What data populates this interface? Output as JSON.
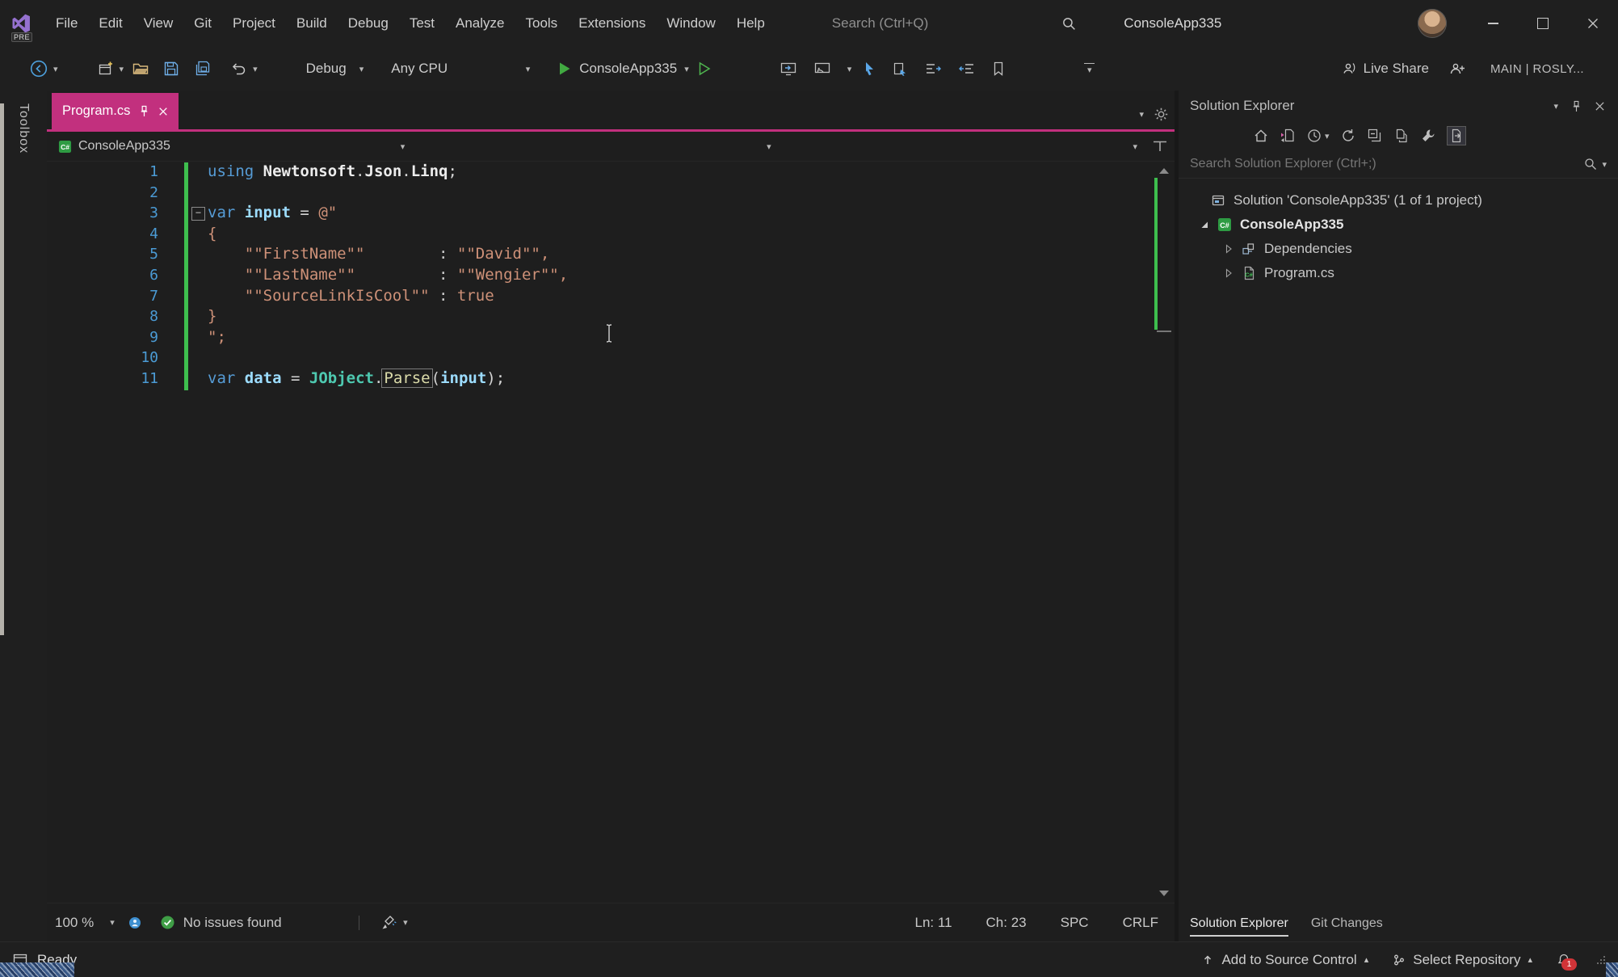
{
  "titlebar": {
    "logo_badge": "PRE",
    "menus": [
      "File",
      "Edit",
      "View",
      "Git",
      "Project",
      "Build",
      "Debug",
      "Test",
      "Analyze",
      "Tools",
      "Extensions",
      "Window",
      "Help"
    ],
    "search": "Search (Ctrl+Q)",
    "title": "ConsoleApp335"
  },
  "toolbar": {
    "config": "Debug",
    "platform": "Any CPU",
    "run_target": "ConsoleApp335",
    "live_share": "Live Share",
    "branch": "MAIN | ROSLY..."
  },
  "left_rail": {
    "toolbox": "Toolbox"
  },
  "editor": {
    "tab": {
      "title": "Program.cs"
    },
    "breadcrumb": {
      "project": "ConsoleApp335"
    },
    "fold_marker": "−",
    "code_lines": [
      {
        "n": "1",
        "tokens": [
          {
            "c": "k",
            "t": "using"
          },
          {
            "c": "p",
            "t": " "
          },
          {
            "c": "n",
            "t": "Newtonsoft"
          },
          {
            "c": "p",
            "t": "."
          },
          {
            "c": "n",
            "t": "Json"
          },
          {
            "c": "p",
            "t": "."
          },
          {
            "c": "n",
            "t": "Linq"
          },
          {
            "c": "p",
            "t": ";"
          }
        ]
      },
      {
        "n": "2",
        "tokens": []
      },
      {
        "n": "3",
        "tokens": [
          {
            "c": "k",
            "t": "var"
          },
          {
            "c": "p",
            "t": " "
          },
          {
            "c": "i",
            "t": "input"
          },
          {
            "c": "p",
            "t": " = "
          },
          {
            "c": "s",
            "t": "@\""
          }
        ]
      },
      {
        "n": "4",
        "tokens": [
          {
            "c": "s",
            "t": "{"
          }
        ]
      },
      {
        "n": "5",
        "tokens": [
          {
            "c": "s",
            "t": "    \"\"FirstName\"\"        "
          },
          {
            "c": "c",
            "t": ":"
          },
          {
            "c": "s",
            "t": " \"\"David\"\","
          }
        ]
      },
      {
        "n": "6",
        "tokens": [
          {
            "c": "s",
            "t": "    \"\"LastName\"\"         "
          },
          {
            "c": "c",
            "t": ":"
          },
          {
            "c": "s",
            "t": " \"\"Wengier\"\","
          }
        ]
      },
      {
        "n": "7",
        "tokens": [
          {
            "c": "s",
            "t": "    \"\"SourceLinkIsCool\"\" "
          },
          {
            "c": "c",
            "t": ":"
          },
          {
            "c": "s",
            "t": " true"
          }
        ]
      },
      {
        "n": "8",
        "tokens": [
          {
            "c": "s",
            "t": "}"
          }
        ]
      },
      {
        "n": "9",
        "tokens": [
          {
            "c": "s",
            "t": "\";"
          }
        ]
      },
      {
        "n": "10",
        "tokens": []
      },
      {
        "n": "11",
        "tokens": [
          {
            "c": "k",
            "t": "var"
          },
          {
            "c": "p",
            "t": " "
          },
          {
            "c": "i",
            "t": "data"
          },
          {
            "c": "p",
            "t": " = "
          },
          {
            "c": "t",
            "t": "JObject"
          },
          {
            "c": "p",
            "t": "."
          },
          {
            "c": "mb",
            "t": "Parse"
          },
          {
            "c": "p",
            "t": "("
          },
          {
            "c": "i",
            "t": "input"
          },
          {
            "c": "p",
            "t": ");"
          }
        ]
      }
    ],
    "status": {
      "zoom": "100 %",
      "issues": "No issues found",
      "ln": "Ln: 11",
      "ch": "Ch: 23",
      "spc": "SPC",
      "eol": "CRLF"
    }
  },
  "solution_explorer": {
    "title": "Solution Explorer",
    "search_placeholder": "Search Solution Explorer (Ctrl+;)",
    "tree": [
      {
        "label": "Solution 'ConsoleApp335' (1 of 1 project)",
        "icon": "solution",
        "arrow": "none",
        "level": 0
      },
      {
        "label": "ConsoleApp335",
        "icon": "csproj",
        "arrow": "open",
        "level": 1,
        "bold": true
      },
      {
        "label": "Dependencies",
        "icon": "dependencies",
        "arrow": "closed",
        "level": 2
      },
      {
        "label": "Program.cs",
        "icon": "csfile",
        "arrow": "closed",
        "level": 2
      }
    ],
    "bottom_tabs": [
      {
        "label": "Solution Explorer",
        "active": true
      },
      {
        "label": "Git Changes",
        "active": false
      }
    ]
  },
  "statusbar": {
    "ready": "Ready",
    "add_source": "Add to Source Control",
    "select_repo": "Select Repository",
    "badge": "1"
  },
  "colors": {
    "accent": "#C2307E",
    "change_green": "#3EBE4E",
    "check_green": "#3F9E46",
    "keyword": "#569CD6",
    "identifier": "#9CDCFE",
    "string": "#CE9178",
    "type": "#4EC9B0",
    "method": "#DCDCAA",
    "line_number": "#4B9BD5",
    "badge_red": "#D13438"
  }
}
